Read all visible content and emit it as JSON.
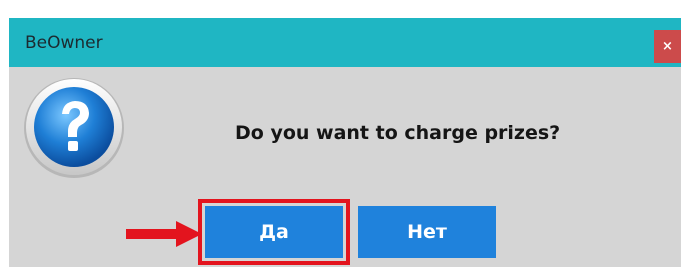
{
  "dialog": {
    "title": "BeOwner",
    "close_label": "×",
    "message": "Do you want to charge prizes?",
    "icon": "question-icon",
    "buttons": {
      "yes_label": "Да",
      "no_label": "Нет"
    }
  },
  "annotation": {
    "arrow_icon": "red-arrow-icon",
    "highlight_target": "yes-button",
    "accent_color": "#e3141e"
  },
  "colors": {
    "titlebar": "#1fb6c3",
    "dialog_bg": "#d5d5d5",
    "button": "#1f82dc",
    "close_button": "#cc4b4b"
  }
}
